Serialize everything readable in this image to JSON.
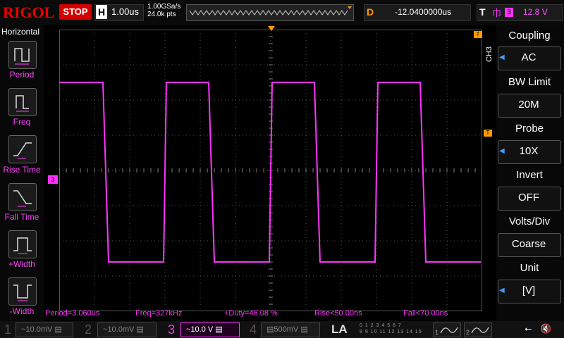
{
  "topbar": {
    "logo": "RIGOL",
    "run_state": "STOP",
    "horizontal_label": "H",
    "time_per_div": "1.00us",
    "sample_rate": "1.00GSa/s",
    "memory_depth": "24.0k pts",
    "delay_label": "D",
    "delay_value": "-12.0400000us",
    "trigger_label": "T",
    "trigger_source": "3",
    "trigger_level": "12.8 V"
  },
  "left_menu": {
    "title": "Horizontal",
    "items": [
      {
        "label": "Period",
        "icon": "period-icon"
      },
      {
        "label": "Freq",
        "icon": "freq-icon"
      },
      {
        "label": "Rise Time",
        "icon": "rise-time-icon"
      },
      {
        "label": "Fall Time",
        "icon": "fall-time-icon"
      },
      {
        "label": "+Width",
        "icon": "pos-width-icon"
      },
      {
        "label": "-Width",
        "icon": "neg-width-icon"
      }
    ]
  },
  "right_menu": {
    "channel_tag": "CH3",
    "items": [
      {
        "title": "Coupling",
        "value": "AC"
      },
      {
        "title": "BW Limit",
        "value": "20M"
      },
      {
        "title": "Probe",
        "value": "10X"
      },
      {
        "title": "Invert",
        "value": "OFF"
      },
      {
        "title": "Volts/Div",
        "value": "Coarse"
      },
      {
        "title": "Unit",
        "value": "[V]"
      }
    ]
  },
  "markers": {
    "ch3_ground": "3",
    "trigger_pos": "T",
    "trigger_level": "T"
  },
  "measurements": [
    "Period=3.060us",
    "Freq=327kHz",
    "+Duty=46.08 %",
    "Rise<50.00ns",
    "Fall<70.00ns"
  ],
  "bottombar": {
    "channels": [
      {
        "num": "1",
        "scale": "10.0mV"
      },
      {
        "num": "2",
        "scale": "10.0mV"
      },
      {
        "num": "3",
        "scale": "10.0 V"
      },
      {
        "num": "4",
        "scale": "500mV"
      }
    ],
    "la": "LA",
    "la_row1": "0 1 2 3  4 5 6 7",
    "la_row2": "8 9 10 11  12 13 14 15",
    "src1": "1",
    "src2": "2"
  },
  "colors": {
    "ch3": "#ff33ff",
    "accent": "#ff9a00",
    "stop": "#d20000"
  }
}
